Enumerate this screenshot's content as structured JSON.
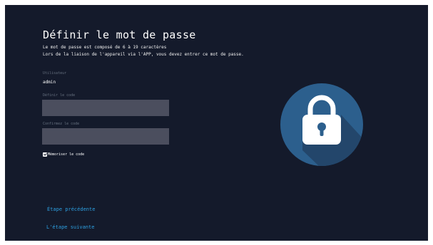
{
  "page": {
    "title": "Définir le mot de passe",
    "description_line1": "Le mot de passe est composé de 6 à 19 caractères",
    "description_line2": "Lors de la liaison de l'appareil via l'APP, vous devez entrer ce mot de passe."
  },
  "form": {
    "user_label": "Utilisateur",
    "user_value": "admin",
    "code_label": "Définir le code",
    "code_value": "",
    "confirm_label": "Confirmez le code",
    "confirm_value": "",
    "remember_label": "Mémoriser le code",
    "remember_checked": true
  },
  "nav": {
    "prev_label": "Étape précédente",
    "next_label": "L'étape suivante"
  },
  "colors": {
    "background": "#141a2b",
    "field": "#4b4e5e",
    "link": "#2d9fe0",
    "lock_circle": "#2c5f8d"
  },
  "icons": {
    "lock": "padlock-icon"
  }
}
